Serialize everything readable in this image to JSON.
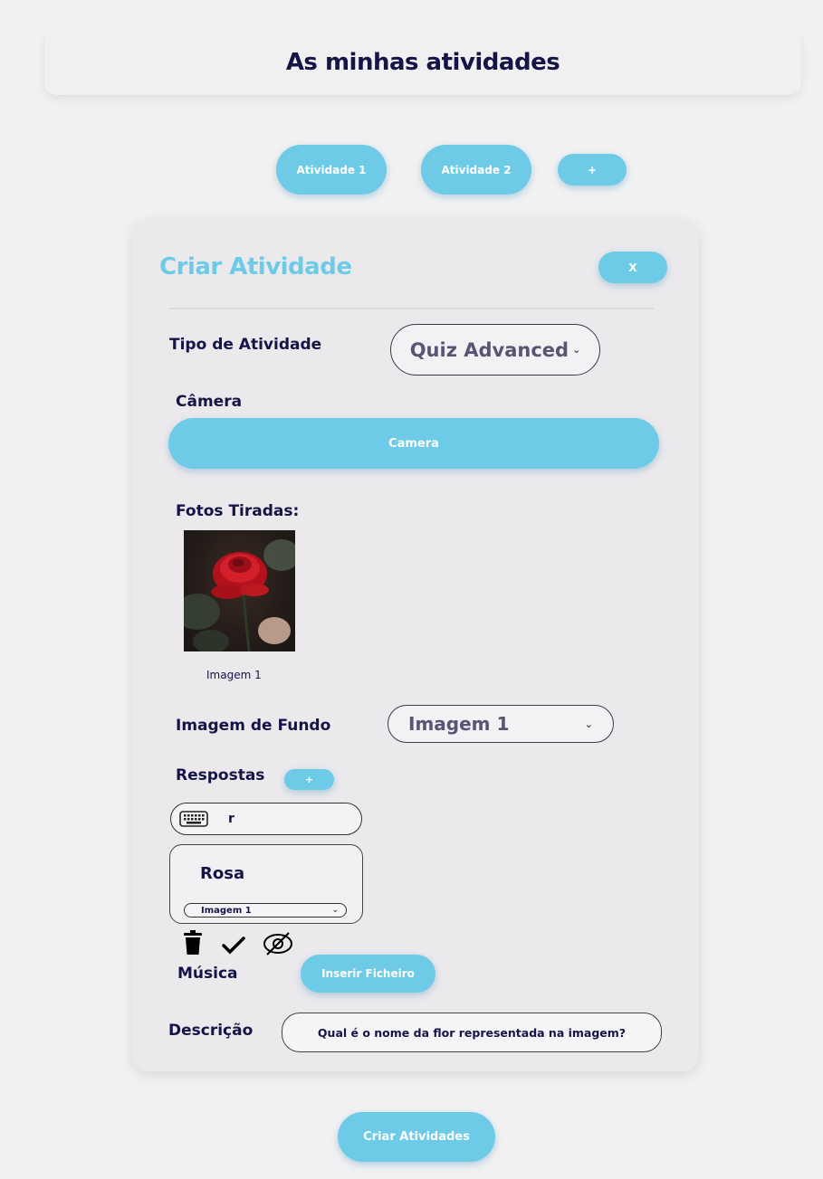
{
  "header": {
    "title": "As minhas atividades"
  },
  "tabs": [
    {
      "label": "Atividade 1"
    },
    {
      "label": "Atividade 2"
    },
    {
      "label": "+"
    }
  ],
  "panel": {
    "title": "Criar Atividade",
    "close_label": "X",
    "activity_type": {
      "label": "Tipo de Atividade",
      "value": "Quiz Advanced"
    },
    "camera": {
      "label": "Câmera",
      "button_label": "Camera"
    },
    "photos": {
      "label": "Fotos Tiradas:",
      "items": [
        {
          "caption": "Imagem 1"
        }
      ]
    },
    "background": {
      "label": "Imagem de Fundo",
      "value": "Imagem 1"
    },
    "answers": {
      "label": "Respostas",
      "add_label": "+",
      "input_value": "r",
      "card": {
        "text": "Rosa",
        "image_select": "Imagem 1"
      }
    },
    "music": {
      "label": "Música",
      "button_label": "Inserir Ficheiro"
    },
    "description": {
      "label": "Descrição",
      "value": "Qual é o nome da flor representada na imagem?"
    }
  },
  "footer": {
    "submit_label": "Criar Atividades"
  },
  "colors": {
    "accent": "#6dcbe7",
    "text": "#141447",
    "muted": "#585474"
  }
}
